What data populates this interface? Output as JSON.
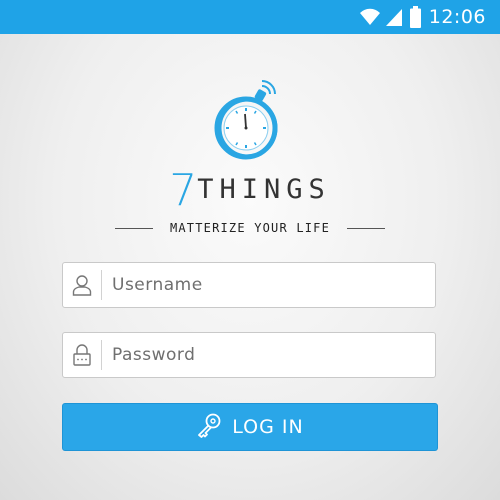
{
  "status_bar": {
    "time": "12:06",
    "icons": [
      "wifi-icon",
      "signal-icon",
      "battery-icon"
    ],
    "background": "#1fa3e7"
  },
  "app": {
    "logo_icon": "stopwatch-icon",
    "brand_number": "7",
    "brand_word": "THINGS",
    "tagline": "MATTERIZE YOUR LIFE",
    "accent_color": "#2aa6e3"
  },
  "form": {
    "username": {
      "placeholder": "Username",
      "value": "",
      "icon": "user-icon"
    },
    "password": {
      "placeholder": "Password",
      "value": "",
      "icon": "lock-icon"
    },
    "login_label": "LOG IN",
    "login_icon": "key-icon"
  }
}
